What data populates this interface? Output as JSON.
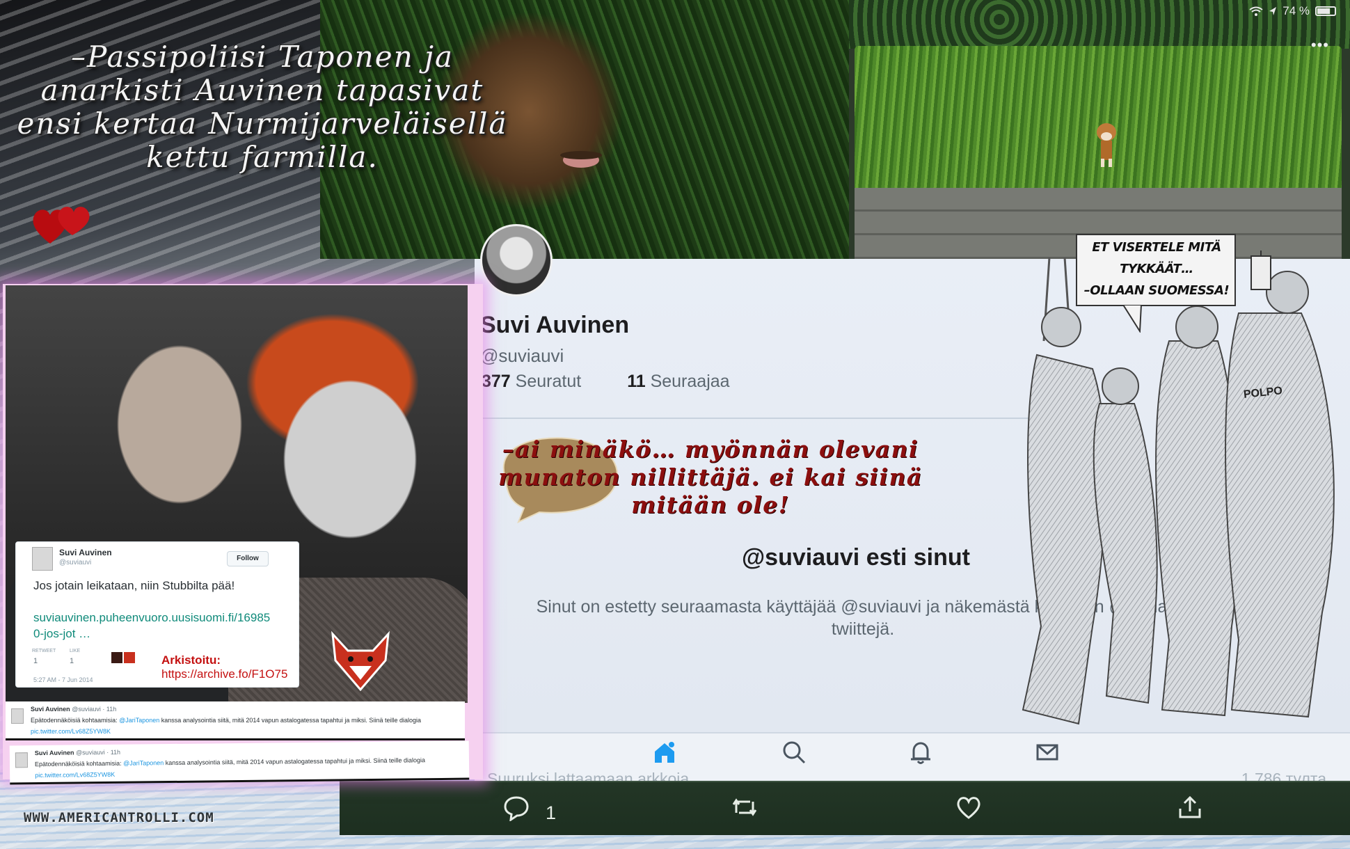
{
  "caption": {
    "line1": "–Passipoliisi Taponen ja",
    "line2": "anarkisti Auvinen tapasivat",
    "line3": "ensi kertaa Nurmijarveläisellä",
    "line4": "kettu farmilla."
  },
  "status_bar": {
    "battery": "74 %"
  },
  "profile": {
    "name": "Suvi Auvinen",
    "handle": "@suviauvi",
    "following_count": "377",
    "following_label": "Seuratut",
    "followers_count": "11",
    "followers_label": "Seuraajaa"
  },
  "red_quote": {
    "line1": "–ai minäkö… myönnän olevani",
    "line2": "munaton nillittäjä. ei kai siinä",
    "line3": "mitään ole!"
  },
  "blocked": {
    "title": "@suviauvi esti sinut",
    "description_line1": "Sinut on estetty seuraamasta käyttäjää @suviauvi ja näkemästä käyttäjän @suviauvi",
    "description_line2": "twiittejä."
  },
  "tab_bar": {
    "items": [
      "home-icon",
      "search-icon",
      "bell-icon",
      "mail-icon"
    ],
    "accent": "#1d9bf0"
  },
  "faded_tweet": {
    "left": "Suuruksi lattaamaan arkkoja",
    "right": "1 786 тулта"
  },
  "action_bar": {
    "reply_count": "1",
    "items": [
      "reply-icon",
      "retweet-icon",
      "like-icon",
      "share-icon"
    ]
  },
  "comic": {
    "line1": "ET VISERTELE MITÄ",
    "line2": "TYKKÄÄT…",
    "line3": "–OLLAAN SUOMESSA!",
    "polpo": "POLPO"
  },
  "embedded_tweet": {
    "name": "Suvi Auvinen",
    "handle": "@suviauvi",
    "follow_label": "Follow",
    "text": "Jos jotain leikataan, niin Stubbilta pää!",
    "link_line1": "suviauvinen.puheenvuoro.uusisuomi.fi/16985",
    "link_line2": "0-jos-jot …",
    "retweet_label": "RETWEET",
    "like_label": "LIKE",
    "retweet_count": "1",
    "like_count": "1",
    "date": "5:27 AM - 7 Jun 2014",
    "archive_label": "Arkistoitu:",
    "archive_url": "https://archive.fo/F1O75"
  },
  "tweet_strips": [
    {
      "name": "Suvi Auvinen",
      "meta": "@suviauvi · 11h",
      "body_pre": "Epätodennäköisiä kohtaamisia: ",
      "mention": "@JariTaponen",
      "body_post": " kanssa analysointia siitä, mitä 2014 vapun astalogatessa tapahtui ja miksi. Siinä teille dialogia",
      "link": "pic.twitter.com/Lv68Z5YW8K"
    },
    {
      "name": "Suvi Auvinen",
      "meta": "@suviauvi · 11h",
      "body_pre": "Epätodennäköisiä kohtaamisia: ",
      "mention": "@JariTaponen",
      "body_post": " kanssa analysointia siitä, mitä 2014 vapun astalogatessa tapahtui ja miksi. Siinä teille dialogia",
      "link": "pic.twitter.com/Lv68Z5YW8K"
    }
  ],
  "watermark": "WWW.AMERICANTROLLI.COM"
}
